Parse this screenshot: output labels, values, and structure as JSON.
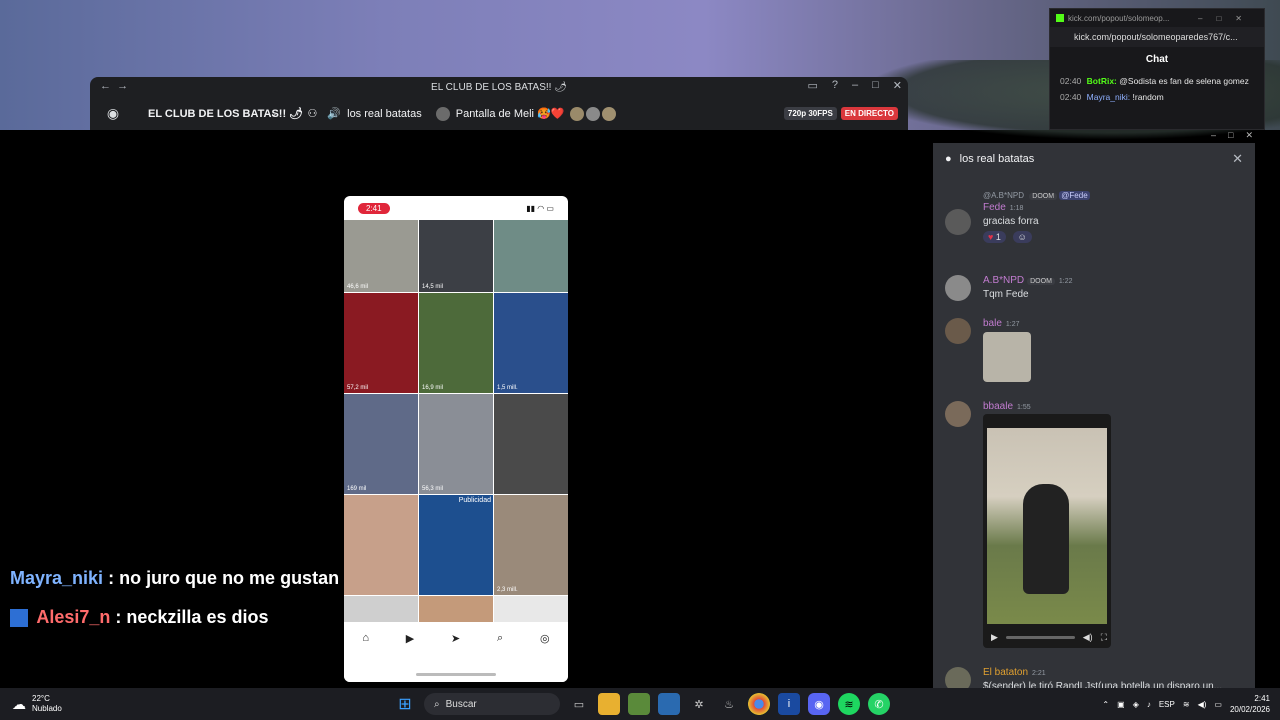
{
  "discord": {
    "window_title": "EL CLUB DE LOS BATAS!! 🌶",
    "server_name": "EL CLUB DE LOS BATAS!! 🌶",
    "voice_channel": "los real batatas",
    "stream_label": "Pantalla de Meli 🥵❤️",
    "quality_badge": "720p 30FPS",
    "live_badge": "EN DIRECTO"
  },
  "kick": {
    "bar_url": "kick.com/popout/solomeop...",
    "address": "kick.com/popout/solomeoparedes767/c...",
    "chat_title": "Chat",
    "messages": [
      {
        "time": "02:40",
        "user": "BotRix:",
        "text": "@Sodista es fan de selena gomez"
      },
      {
        "time": "02:40",
        "user": "Mayra_niki:",
        "text": "!random"
      }
    ]
  },
  "phone": {
    "clock": "2:41",
    "tiles": [
      {
        "views": "46,6 mil",
        "color": "#9a9a92"
      },
      {
        "views": "14,5 mil",
        "color": "#3c3f45"
      },
      {
        "views": "",
        "color": "#6f8c86"
      },
      {
        "views": "57,2 mil",
        "color": "#8a1a22"
      },
      {
        "views": "16,9 mil",
        "color": "#4d6a3a"
      },
      {
        "views": "1,5 mill.",
        "color": "#2a4f8c"
      },
      {
        "views": "169 mil",
        "color": "#5f6a88"
      },
      {
        "views": "56,3 mil",
        "color": "#8a8e96"
      },
      {
        "views": "",
        "color": "#4a4a4a"
      },
      {
        "views": "",
        "color": "#c7a08a"
      },
      {
        "views": "",
        "color": "#1d4f8f"
      },
      {
        "views": "2,3 mill.",
        "color": "#9a8a7a"
      },
      {
        "views": "",
        "color": "#cfcfcf"
      },
      {
        "views": "",
        "color": "#c49a7a"
      },
      {
        "views": "",
        "color": "#e8e8e8"
      }
    ],
    "ad_label": "Publicidad"
  },
  "overlay_chat": [
    {
      "user": "Mayra_niki",
      "text": ": no juro que no me gustan",
      "color": "#7fb3ff"
    },
    {
      "user": "Alesi7_n",
      "text": ": neckzilla es dios",
      "color": "#ff6b6b"
    }
  ],
  "panel": {
    "title": "los real batatas",
    "messages": [
      {
        "reply_user": "@A.B*NPD",
        "reply_tag": "DOOM",
        "reply_mention": "@Fede",
        "user": "Fede",
        "time": "1:18",
        "text": "gracias forra",
        "reaction_count": "1"
      },
      {
        "user": "A.B*NPD",
        "tag": "DOOM",
        "time": "1:22",
        "text": "Tqm Fede"
      },
      {
        "user": "bale",
        "time": "1:27"
      },
      {
        "user": "bbaale",
        "time": "1:55"
      },
      {
        "user": "El bataton",
        "time": "2:21",
        "text": "$(sender) le tiró RandLJst(una botella,un disparo,un..."
      }
    ]
  },
  "taskbar": {
    "temp": "22°C",
    "weather": "Nublado",
    "search": "Buscar",
    "lang": "ESP",
    "time": "2:41",
    "date": "20/02/2026"
  }
}
